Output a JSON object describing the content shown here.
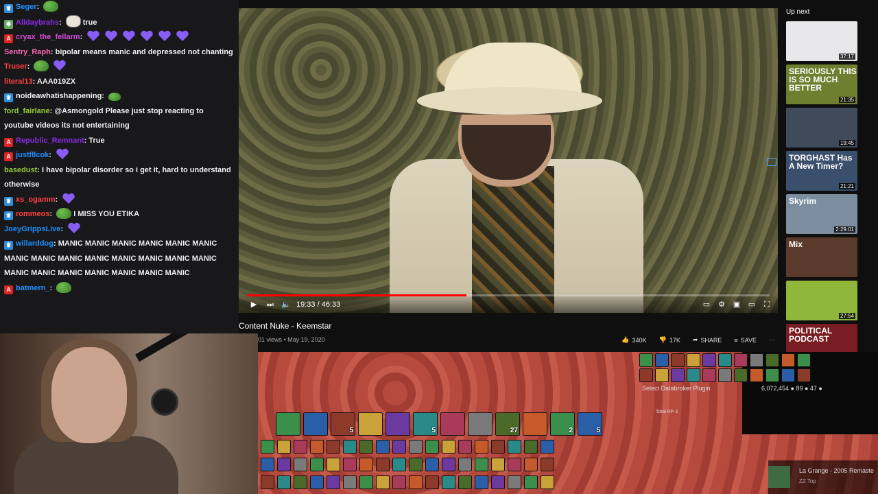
{
  "chat": {
    "messages": [
      {
        "user": "Seger",
        "text": "",
        "color": "#1e90ff",
        "badge": "prime",
        "emotes": [
          "pepe"
        ]
      },
      {
        "user": "Alldaybrahs",
        "text": "true",
        "color": "#8a2be2",
        "badge": "mod",
        "emotes": [
          "troll"
        ]
      },
      {
        "user": "cryax_the_fellarm",
        "text": "",
        "color": "#d64bd6",
        "badge": "sub",
        "emotes": [
          "heart",
          "heart",
          "heart",
          "heart",
          "heart",
          "heart"
        ]
      },
      {
        "user": "Sentry_Raph",
        "text": "bipolar means manic and depressed not chanting",
        "color": "#ff69b4",
        "badge": "",
        "emotes": []
      },
      {
        "user": "Truser",
        "text": "",
        "color": "#ff4040",
        "badge": "",
        "emotes": [
          "pepe",
          "heart"
        ]
      },
      {
        "user": "literal13",
        "text": "AAA019ZX",
        "color": "#ff4040",
        "badge": "",
        "emotes": []
      },
      {
        "user": "noideawhatishappening",
        "text": "",
        "color": "#efeff1",
        "badge": "prime",
        "emotes": [
          "pepe-small"
        ]
      },
      {
        "user": "ford_fairlane",
        "text": "@Asmongold Please just stop reacting to youtube videos its not entertaining",
        "color": "#9acd32",
        "badge": "",
        "emotes": []
      },
      {
        "user": "Republic_Remnant",
        "text": "True",
        "color": "#8a2be2",
        "badge": "sub",
        "emotes": []
      },
      {
        "user": "justfllcok",
        "text": "",
        "color": "#1e90ff",
        "badge": "sub",
        "emotes": [
          "heart"
        ]
      },
      {
        "user": "basedust",
        "text": "I have bipolar disorder so i get it, hard to understand otherwise",
        "color": "#9acd32",
        "badge": "",
        "emotes": []
      },
      {
        "user": "xs_ogamm",
        "text": "",
        "color": "#ff4040",
        "badge": "prime",
        "emotes": [
          "heart"
        ]
      },
      {
        "user": "rommeos",
        "text": "I MISS YOU ETIKA",
        "color": "#ff4040",
        "badge": "prime",
        "emotes": [
          "pepe"
        ]
      },
      {
        "user": "JoeyGrippsLive",
        "text": "",
        "color": "#1e90ff",
        "badge": "",
        "emotes": [
          "heart"
        ]
      },
      {
        "user": "willarddog",
        "text": "MANIC MANIC MANIC MANIC MANIC MANIC MANIC MANIC MANIC MANIC MANIC MANIC MANIC MANIC MANIC MANIC MANIC MANIC MANIC MANIC MANIC",
        "color": "#1e90ff",
        "badge": "prime",
        "emotes": []
      },
      {
        "user": "batmern_",
        "text": "",
        "color": "#1e90ff",
        "badge": "sub",
        "emotes": [
          "pepe"
        ]
      }
    ]
  },
  "video": {
    "time": "19:33 / 46:33",
    "progress": 0.42,
    "title": "Content Nuke - Keemstar",
    "meta": "01 views • May 19, 2020",
    "likes": "340K",
    "dislikes": "17K",
    "share": "SHARE",
    "save": "SAVE"
  },
  "upnext": {
    "label": "Up next",
    "items": [
      {
        "duration": "37:17",
        "caption": "",
        "bg": "#e8e8ea"
      },
      {
        "duration": "21:35",
        "caption": "SERIOUSLY THIS IS SO MUCH BETTER",
        "bg": "#6f7f2f"
      },
      {
        "duration": "19:45",
        "caption": "",
        "bg": "#3f4a5a"
      },
      {
        "duration": "21:21",
        "caption": "TORGHAST Has A New Timer?",
        "bg": "#3a4f6b"
      },
      {
        "duration": "2:29:01",
        "caption": "Skyrim",
        "bg": "#7c8da0"
      },
      {
        "duration": "",
        "caption": "Mix",
        "bg": "#5a3a2a"
      },
      {
        "duration": "27:54",
        "caption": "",
        "bg": "#8fb83a"
      },
      {
        "duration": "",
        "caption": "POLITICAL PODCAST",
        "bg": "#7a1d22"
      }
    ]
  },
  "game": {
    "databroker": "Select Databroker Plugin",
    "gold": "6,072,454 ● 89 ● 47 ●",
    "total_rp": "Total RP 3",
    "slot_numbers": [
      "5",
      "5",
      "27",
      "5",
      "2"
    ],
    "track_title": "La Grange - 2005 Remaste",
    "track_artist": "ZZ Top"
  }
}
